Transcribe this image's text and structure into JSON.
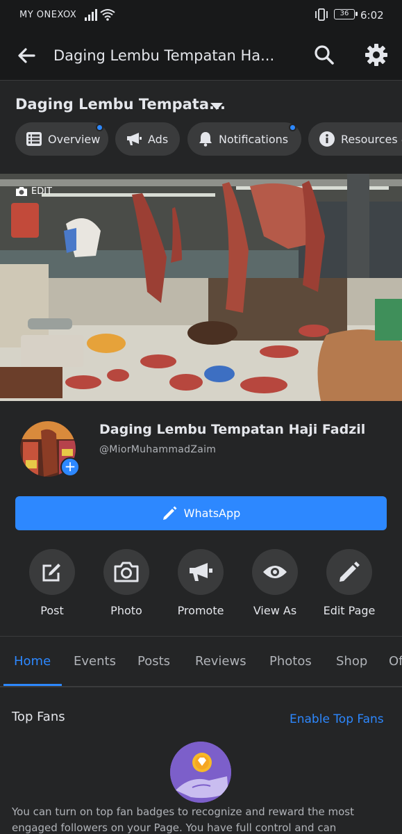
{
  "status_bar": {
    "carrier": "MY ONEXOX",
    "battery": "36",
    "time": "6:02",
    "icons": [
      "signal-icon",
      "wifi-icon",
      "vibrate-icon",
      "battery-icon"
    ]
  },
  "app_bar": {
    "title": "Daging Lembu Tempatan Ha...",
    "icons": [
      "back-arrow-icon",
      "search-icon",
      "gear-icon"
    ]
  },
  "page_header": {
    "name": "Daging Lembu Tempata...",
    "chips": [
      {
        "label": "Overview",
        "icon": "list-icon",
        "dot": true
      },
      {
        "label": "Ads",
        "icon": "megaphone-icon",
        "dot": false
      },
      {
        "label": "Notifications",
        "icon": "bell-icon",
        "dot": true
      },
      {
        "label": "Resources &",
        "icon": "info-icon",
        "dot": false
      }
    ]
  },
  "cover": {
    "edit_label": "EDIT"
  },
  "profile": {
    "full_name": "Daging Lembu Tempatan Haji Fadzil",
    "handle": "@MiorMuhammadZaim",
    "add_symbol": "+",
    "cta_label": "WhatsApp",
    "actions": [
      {
        "label": "Post",
        "icon": "compose-icon"
      },
      {
        "label": "Photo",
        "icon": "camera-icon"
      },
      {
        "label": "Promote",
        "icon": "megaphone-icon"
      },
      {
        "label": "View As",
        "icon": "eye-icon"
      },
      {
        "label": "Edit Page",
        "icon": "pencil-icon"
      }
    ]
  },
  "tabs": {
    "items": [
      "Home",
      "Events",
      "Posts",
      "Reviews",
      "Photos",
      "Shop",
      "Of"
    ],
    "active": "Home"
  },
  "top_fans": {
    "title": "Top Fans",
    "enable_label": "Enable Top Fans",
    "description": "You can turn on top fan badges to recognize and reward the most engaged followers on your Page. You have full control and can"
  },
  "colors": {
    "accent": "#2d88ff",
    "surface": "#242526",
    "chip": "#3a3b3c",
    "text": "#e4e6eb",
    "text_secondary": "#b0b3b8"
  }
}
